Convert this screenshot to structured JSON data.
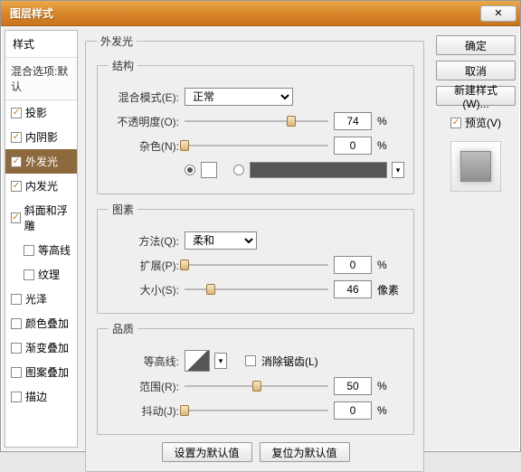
{
  "window": {
    "title": "图层样式",
    "close": "✕"
  },
  "styles_panel": {
    "header": "样式",
    "blend_options": "混合选项:默认",
    "items": [
      {
        "label": "投影",
        "checked": true
      },
      {
        "label": "内阴影",
        "checked": true
      },
      {
        "label": "外发光",
        "checked": true,
        "selected": true
      },
      {
        "label": "内发光",
        "checked": true
      },
      {
        "label": "斜面和浮雕",
        "checked": true
      },
      {
        "label": "等高线",
        "checked": false,
        "sub": true
      },
      {
        "label": "纹理",
        "checked": false,
        "sub": true
      },
      {
        "label": "光泽",
        "checked": false
      },
      {
        "label": "颜色叠加",
        "checked": false
      },
      {
        "label": "渐变叠加",
        "checked": false
      },
      {
        "label": "图案叠加",
        "checked": false
      },
      {
        "label": "描边",
        "checked": false
      }
    ]
  },
  "outer_glow": {
    "legend": "外发光",
    "structure": {
      "legend": "结构",
      "blend_mode": {
        "label": "混合模式(E):",
        "value": "正常"
      },
      "opacity": {
        "label": "不透明度(O):",
        "value": "74",
        "unit": "%",
        "pos": 74
      },
      "noise": {
        "label": "杂色(N):",
        "value": "0",
        "unit": "%",
        "pos": 0
      },
      "color": "#ffffff",
      "color_label": "",
      "gradient": "#555555"
    },
    "elements": {
      "legend": "图素",
      "technique": {
        "label": "方法(Q):",
        "value": "柔和"
      },
      "spread": {
        "label": "扩展(P):",
        "value": "0",
        "unit": "%",
        "pos": 0
      },
      "size": {
        "label": "大小(S):",
        "value": "46",
        "unit": "像素",
        "pos": 18
      }
    },
    "quality": {
      "legend": "品质",
      "contour": {
        "label": "等高线:"
      },
      "antialias": {
        "label": "消除锯齿(L)",
        "checked": false
      },
      "range": {
        "label": "范围(R):",
        "value": "50",
        "unit": "%",
        "pos": 50
      },
      "jitter": {
        "label": "抖动(J):",
        "value": "0",
        "unit": "%",
        "pos": 0
      }
    },
    "defaults": {
      "set": "设置为默认值",
      "reset": "复位为默认值"
    }
  },
  "buttons": {
    "ok": "确定",
    "cancel": "取消",
    "new_style": "新建样式(W)...",
    "preview": "预览(V)"
  }
}
